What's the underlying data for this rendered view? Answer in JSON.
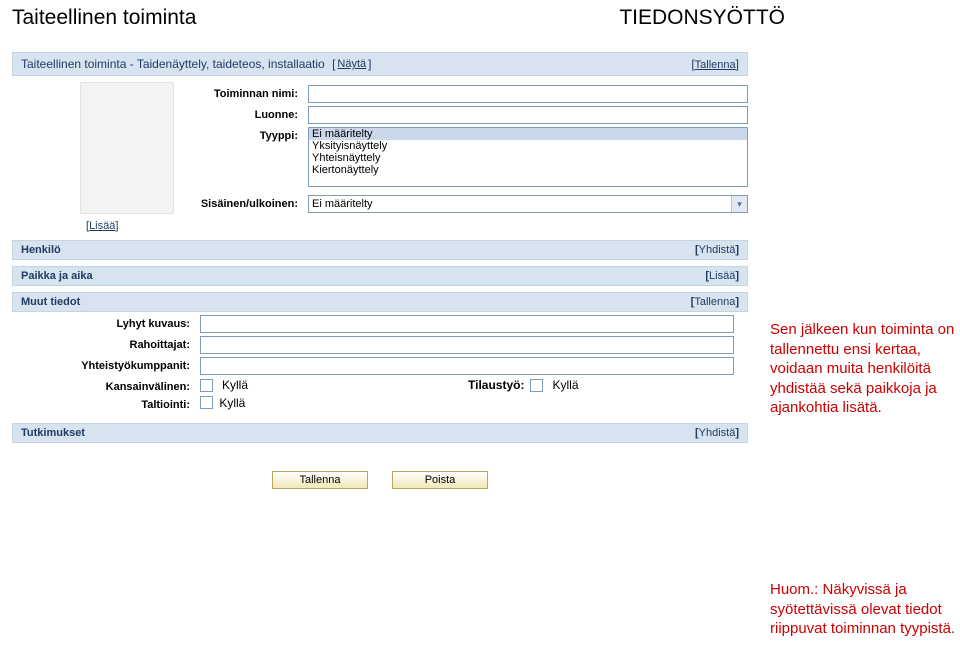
{
  "header": {
    "left": "Taiteellinen toiminta",
    "right": "TIEDONSYÖTTÖ"
  },
  "main_section": {
    "title": "Taiteellinen toiminta - Taidenäyttely, taideteos, installaatio",
    "show_link": "Näytä",
    "save_link": "Tallenna"
  },
  "fields": {
    "name_label": "Toiminnan nimi:",
    "name_value": "",
    "nature_label": "Luonne:",
    "nature_value": "",
    "type_label": "Tyyppi:",
    "type_options": [
      "Ei määritelty",
      "Yksityisnäyttely",
      "Yhteisnäyttely",
      "Kiertonäyttely"
    ],
    "int_ext_label": "Sisäinen/ulkoinen:",
    "int_ext_value": "Ei määritelty",
    "add_link": "Lisää"
  },
  "sections": {
    "person": {
      "title": "Henkilö",
      "action": "Yhdistä"
    },
    "place_time": {
      "title": "Paikka ja aika",
      "action": "Lisää"
    },
    "other": {
      "title": "Muut tiedot",
      "action": "Tallenna"
    },
    "research": {
      "title": "Tutkimukset",
      "action": "Yhdistä"
    }
  },
  "other_fields": {
    "short_desc_label": "Lyhyt kuvaus:",
    "short_desc_value": "",
    "funders_label": "Rahoittajat:",
    "funders_value": "",
    "partners_label": "Yhteistyökumppanit:",
    "partners_value": "",
    "international_label": "Kansainvälinen:",
    "international_value": "Kyllä",
    "commissioned_label": "Tilaustyö:",
    "commissioned_value": "Kyllä",
    "recording_label": "Taltiointi:",
    "recording_value": "Kyllä"
  },
  "buttons": {
    "save": "Tallenna",
    "delete": "Poista"
  },
  "annotations": {
    "note1": "Sen jälkeen kun toiminta on tallennettu ensi kertaa, voidaan muita henkilöitä yhdistää sekä paikkoja ja ajankohtia lisätä.",
    "note2": "Huom.: Näkyvissä ja syötettävissä olevat tiedot riippuvat toiminnan tyypistä."
  }
}
